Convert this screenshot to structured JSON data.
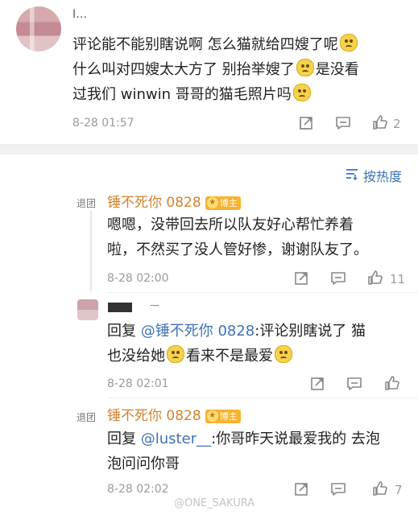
{
  "comment1": {
    "username": "I…",
    "text_line1": "评论能不能别瞎说啊 怎么猫就给四嫂了呢",
    "text_line2a": "什么叫对四嫂太大方了 别抬举嫂了",
    "text_line2b": "是没看",
    "text_line3": "过我们 winwin 哥哥的猫毛照片吗",
    "time": "8-28 01:57",
    "likes": "2"
  },
  "sort": {
    "label": "按热度",
    "icon": "sort-icon"
  },
  "reply1": {
    "tag": "退团",
    "username": "锤不死你 0828",
    "badge": "博主",
    "text_line1": "嗯嗯，没带回去所以队友好心帮忙养着",
    "text_line2": "啦，不然买了没人管好惨，谢谢队友了。",
    "time": "8-28 02:00",
    "likes": "11"
  },
  "reply2": {
    "username": "—",
    "prefix": "回复 ",
    "mention": "@锤不死你 0828",
    "text_line1_rest": ":评论别瞎说了 猫",
    "text_line2a": "也没给她",
    "text_line2b": "看来不是最爱",
    "time": "8-28 02:01",
    "likes": ""
  },
  "reply3": {
    "tag": "退团",
    "username": "锤不死你 0828",
    "badge": "博主",
    "prefix": "回复 ",
    "mention": "@luster__",
    "text_line1_rest": ":你哥昨天说最爱我的 去泡",
    "text_line2": "泡问问你哥",
    "time": "8-28 02:02",
    "likes": "7"
  },
  "watermark": "@ONE_SAKURA",
  "colors": {
    "username": "#d2822c",
    "mention": "#3d72b8",
    "badge": "#f7b22e",
    "meta": "#9a9a9a"
  }
}
